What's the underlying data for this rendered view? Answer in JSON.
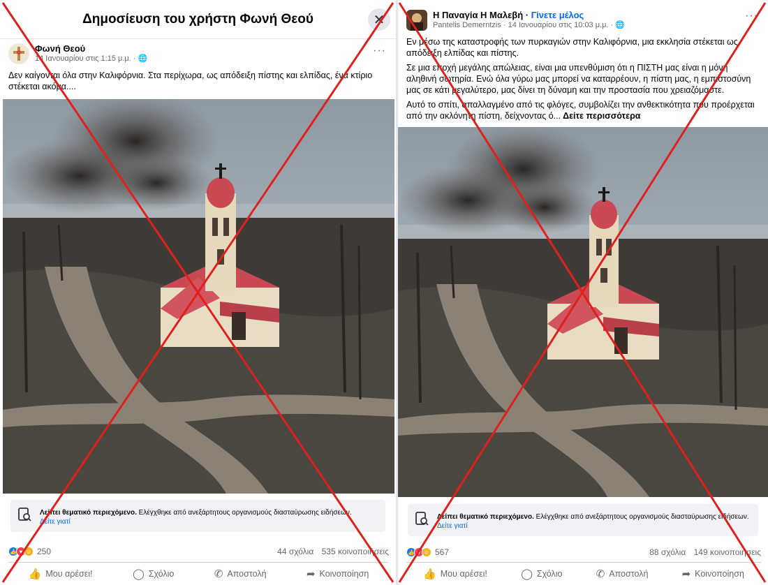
{
  "left_post": {
    "dialog_title": "Δημοσίευση του χρήστη Φωνή Θεού",
    "close_symbol": "✕",
    "author": "Φωνή Θεού",
    "meta": "14 Ιανουαρίου στις 1:15 μ.μ. · ",
    "more_symbol": "···",
    "text": "Δεν καίγονται όλα στην Καλιφόρνια. Στα περίχωρα, ως απόδειξη πίστης και ελπίδας, ένα κτίριο στέκεται ακόμα....",
    "fact_bold": "Λείπει θεματικό περιεχόμενο.",
    "fact_text": " Ελέγχθηκε από ανεξάρτητους οργανισμούς διασταύρωσης ειδήσεων.",
    "fact_link": "Δείτε γιατί",
    "reaction_count": "250",
    "comments": "44 σχόλια",
    "shares": "535 κοινοποιήσεις",
    "actions": {
      "like": "Μου αρέσει!",
      "comment": "Σχόλιο",
      "send": "Αποστολή",
      "share": "Κοινοποίηση"
    }
  },
  "right_post": {
    "page_name": "Η Παναγία Η Μαλεβή",
    "separator": " · ",
    "join_label": "Γίνετε μέλος",
    "meta": "Pantelis Demerntzis · 14 Ιανουαρίου στις 10:03 μ.μ. · ",
    "more_symbol": "···",
    "paragraph1": "Εν μέσω της καταστροφής των πυρκαγιών στην Καλιφόρνια, μια εκκλησία στέκεται ως απόδειξη ελπίδας και πίστης.",
    "paragraph2": "Σε μια εποχή μεγάλης απώλειας, είναι μια υπενθύμιση ότι η ΠΙΣΤΗ μας είναι η μόνη αληθινή σωτηρία. Ενώ όλα γύρω μας μπορεί να καταρρέουν, η πίστη μας, η εμπιστοσύνη μας σε κάτι μεγαλύτερο, μας δίνει τη δύναμη και την προστασία που χρειαζόμαστε.",
    "paragraph3": "Αυτό το σπίτι, απαλλαγμένο από τις φλόγες, συμβολίζει την ανθεκτικότητα που προέρχεται από την ακλόνητη πίστη, δείχνοντας ό...",
    "see_more": " Δείτε περισσότερα",
    "fact_bold": "Λείπει θεματικό περιεχόμενο.",
    "fact_text": " Ελέγχθηκε από ανεξάρτητους οργανισμούς διασταύρωσης ειδήσεων.",
    "fact_link": "Δείτε γιατί",
    "reaction_count": "567",
    "comments": "88 σχόλια",
    "shares": "149 κοινοποιήσεις",
    "actions": {
      "like": "Μου αρέσει!",
      "comment": "Σχόλιο",
      "send": "Αποστολή",
      "share": "Κοινοποίηση"
    }
  },
  "colors": {
    "cross_red": "#e0201c",
    "link_blue": "#0866ff",
    "roof_red": "#c94a55"
  }
}
